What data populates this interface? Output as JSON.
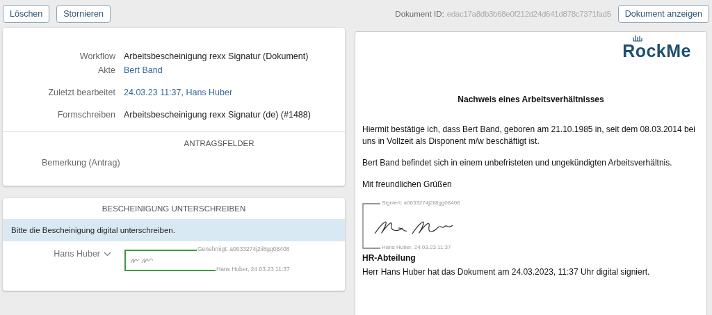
{
  "toolbar": {
    "buttons": [
      "Löschen",
      "Stornieren"
    ],
    "document_id_label": "Dokument ID:",
    "document_id": "edac17a8db3b68e0f212d24d641d878c7371fad5",
    "show_button": "Dokument anzeigen"
  },
  "details": {
    "fields": [
      {
        "label": "Workflow",
        "value": "Arbeitsbescheinigung rexx Signatur (Dokument)",
        "kind": "text"
      },
      {
        "label": "Akte",
        "value": "Bert Band",
        "kind": "link"
      },
      {
        "label": "Zuletzt bearbeitet",
        "value": "24.03.23 11:37, Hans Huber",
        "kind": "link"
      },
      {
        "label": "Formschreiben",
        "value": "Arbeitsbescheinigung rexx Signatur (de) (#1488)",
        "kind": "text"
      }
    ],
    "section_title": "ANTRAGSFELDER",
    "remark_label": "Bemerkung (Antrag)"
  },
  "signing": {
    "title": "BESCHEINIGUNG UNTERSCHREIBEN",
    "notice": "Bitte die Bescheinigung digital unterschreiben.",
    "signer": "Hans Huber",
    "approved": "Genehmigt: a0633274j2ii8gg08408",
    "stamp": "Hans Huber, 24.03.23 11:37"
  },
  "document": {
    "logo": "RockMe",
    "title": "Nachweis eines Arbeitsverhältnisses",
    "paragraphs": [
      "Hiermit bestätige ich, dass Bert Band, geboren am 21.10.1985 in, seit dem 08.03.2014 bei uns in Vollzeit als Disponent m/w beschäftigt ist.",
      "Bert Band befindet sich in einem unbefristeten und ungekündigten Arbeitsverhältnis."
    ],
    "closing": "Mit freundlichen Grüßen",
    "signed": "Signiert: a0633274j2ii8gg08408",
    "stamp": "Hans Huber, 24.03.23 11:37",
    "department": "HR-Abteilung",
    "footer": "Herr Hans Huber hat das Dokument am 24.03.2023, 11:37 Uhr digital signiert."
  }
}
